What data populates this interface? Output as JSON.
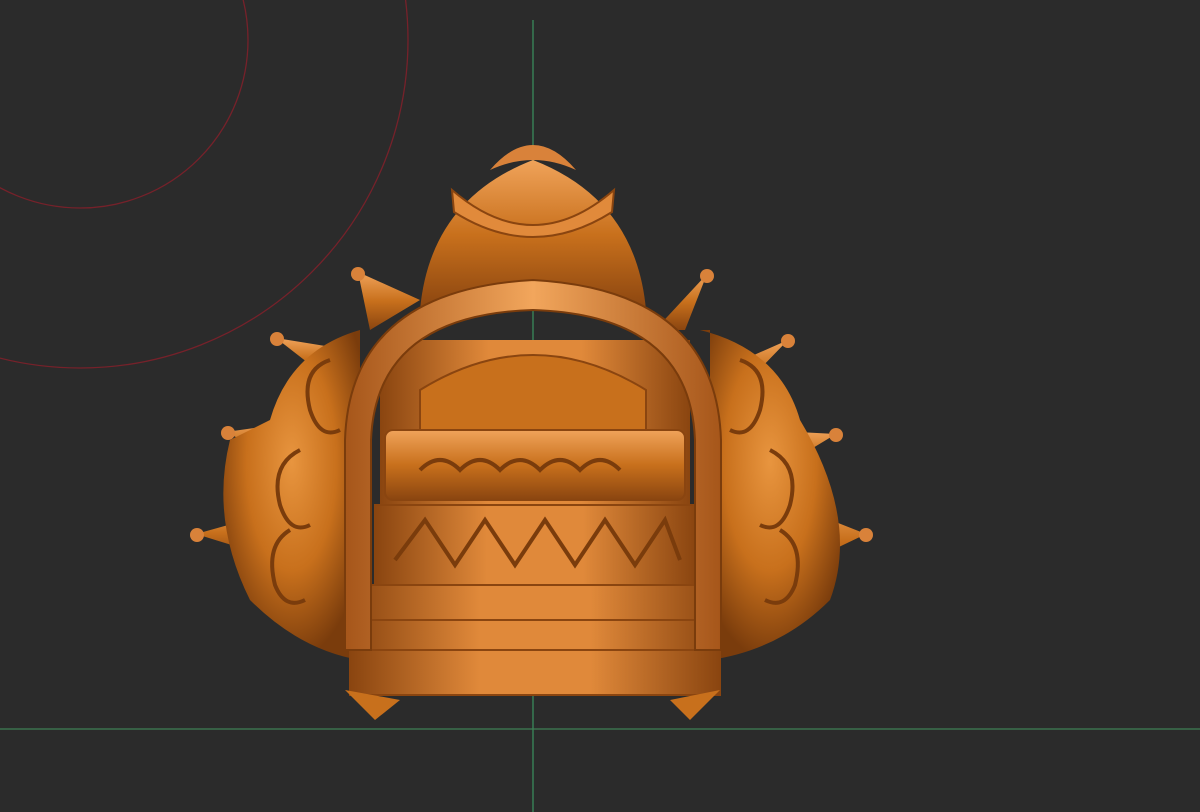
{
  "viewport": {
    "background": "#2b2b2b",
    "x_axis_color": "#3f7f55",
    "y_axis_color": "#3a8a5a",
    "brush_ring_color": "#8a1f2a",
    "material_color": "#c8701c",
    "material_highlight": "#f0a35a",
    "material_shadow": "#7a3c0c"
  },
  "model": {
    "icon": "sculpted-crown-helmet-model"
  }
}
